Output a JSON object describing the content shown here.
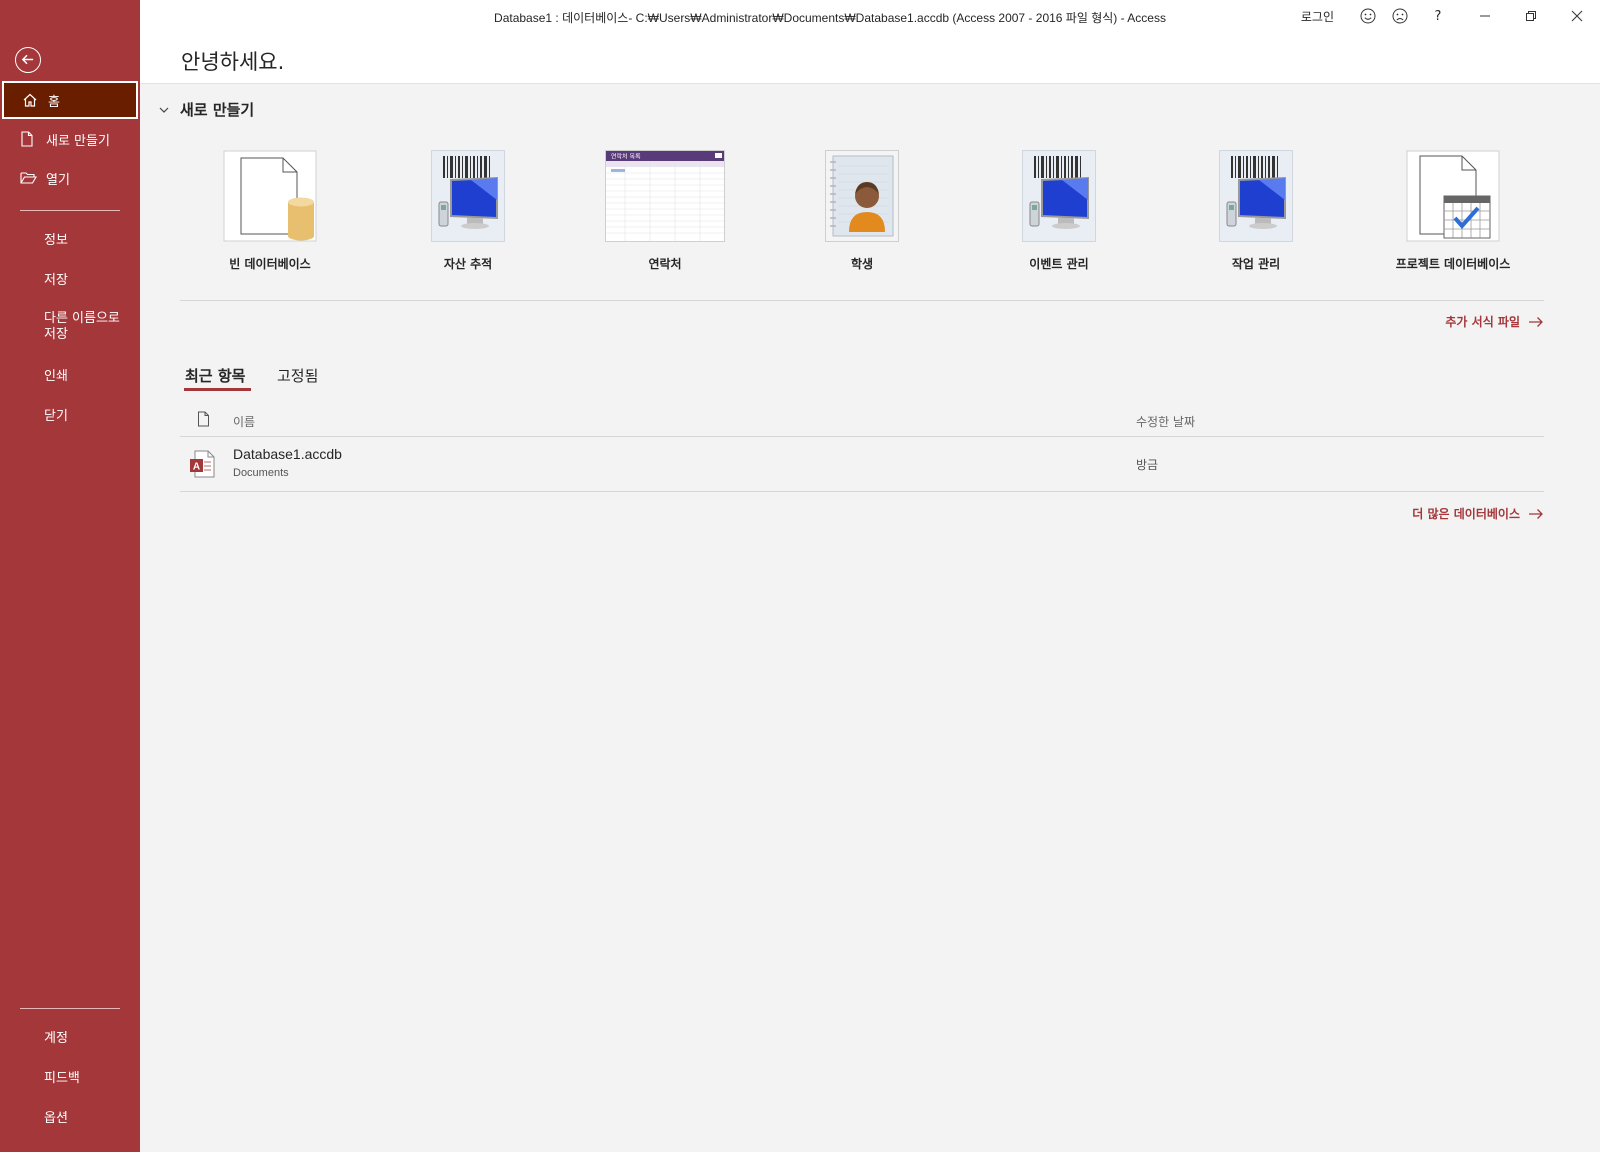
{
  "window": {
    "title": "Database1 : 데이터베이스- C:₩Users₩Administrator₩Documents₩Database1.accdb (Access 2007 - 2016 파일 형식)  -  Access",
    "login": "로그인",
    "help": "?",
    "accent": "#a4373a",
    "accent_dark": "#6a1e00"
  },
  "sidebar": {
    "items": [
      {
        "label": "홈",
        "icon": "home-icon"
      },
      {
        "label": "새로 만들기",
        "icon": "new-document-icon"
      },
      {
        "label": "열기",
        "icon": "open-folder-icon"
      },
      {
        "label": "정보"
      },
      {
        "label": "저장"
      },
      {
        "label": "다른 이름으로\n저장"
      },
      {
        "label": "인쇄"
      },
      {
        "label": "닫기"
      }
    ],
    "bottom_items": [
      {
        "label": "계정"
      },
      {
        "label": "피드백"
      },
      {
        "label": "옵션"
      }
    ]
  },
  "header": {
    "greeting": "안녕하세요."
  },
  "new_section": {
    "title": "새로 만들기",
    "templates": [
      {
        "label": "빈 데이터베이스",
        "icon": "blank-database-icon"
      },
      {
        "label": "자산 추적",
        "icon": "asset-tracking-icon"
      },
      {
        "label": "연락처",
        "icon": "contacts-icon"
      },
      {
        "label": "학생",
        "icon": "students-icon"
      },
      {
        "label": "이벤트 관리",
        "icon": "event-management-icon"
      },
      {
        "label": "작업 관리",
        "icon": "task-management-icon"
      },
      {
        "label": "프로젝트 데이터베이스",
        "icon": "project-database-icon"
      }
    ],
    "contacts_preview_title": "연락처 목록",
    "more_templates": "추가 서식 파일"
  },
  "recent": {
    "tabs": [
      "최근 항목",
      "고정됨"
    ],
    "columns": {
      "name": "이름",
      "modified": "수정한 날짜"
    },
    "files": [
      {
        "name": "Database1.accdb",
        "path": "Documents",
        "modified": "방금",
        "icon": "access-file-icon"
      }
    ],
    "more_databases": "더 많은 데이터베이스"
  }
}
